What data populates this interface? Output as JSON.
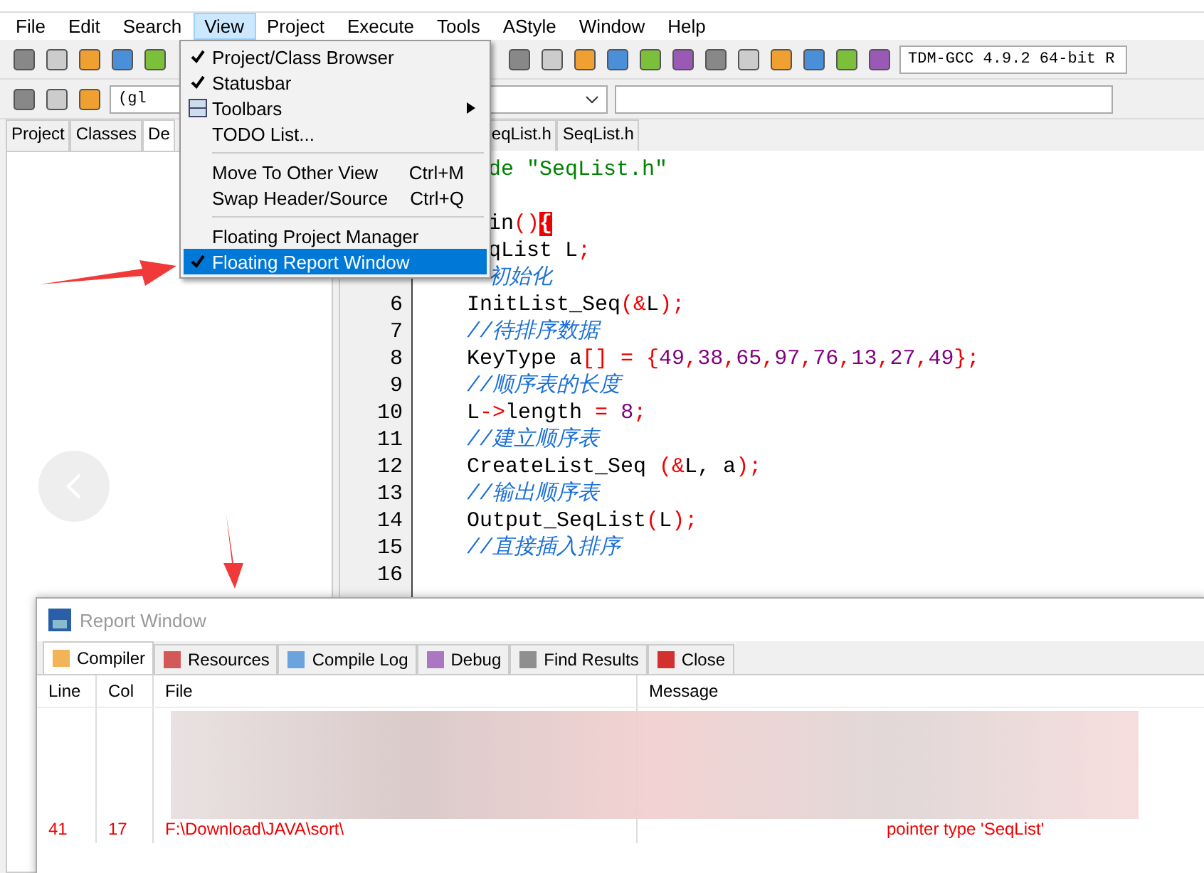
{
  "menu_bar": [
    {
      "label": "File",
      "selected": false
    },
    {
      "label": "Edit",
      "selected": false
    },
    {
      "label": "Search",
      "selected": false
    },
    {
      "label": "View",
      "selected": true
    },
    {
      "label": "Project",
      "selected": false
    },
    {
      "label": "Execute",
      "selected": false
    },
    {
      "label": "Tools",
      "selected": false
    },
    {
      "label": "AStyle",
      "selected": false
    },
    {
      "label": "Window",
      "selected": false
    },
    {
      "label": "Help",
      "selected": false
    }
  ],
  "compiler_select": {
    "value": "TDM-GCC 4.9.2 64-bit R"
  },
  "scope_select": {
    "value": "(gl"
  },
  "left_tabs": [
    {
      "label": "Project",
      "selected": false
    },
    {
      "label": "Classes",
      "selected": false
    },
    {
      "label": "De",
      "selected": true
    }
  ],
  "editor_tabs": [
    {
      "label": "eqList.h",
      "selected": false
    },
    {
      "label": "SeqList.h",
      "selected": false
    }
  ],
  "view_menu": [
    {
      "kind": "item",
      "label": "Project/Class Browser",
      "checked": true,
      "has_submenu": false,
      "highlighted": false
    },
    {
      "kind": "item",
      "label": "Statusbar",
      "checked": true,
      "has_submenu": false,
      "highlighted": false
    },
    {
      "kind": "toolbar",
      "label": "Toolbars",
      "has_submenu": true,
      "highlighted": false
    },
    {
      "kind": "item",
      "label": "TODO List...",
      "checked": false,
      "has_submenu": false,
      "highlighted": false
    },
    {
      "kind": "separator"
    },
    {
      "kind": "item",
      "label": "Move To Other View",
      "shortcut": "Ctrl+M",
      "checked": false,
      "has_submenu": false,
      "highlighted": false
    },
    {
      "kind": "item",
      "label": "Swap Header/Source",
      "shortcut": "Ctrl+Q",
      "checked": false,
      "has_submenu": false,
      "highlighted": false
    },
    {
      "kind": "separator"
    },
    {
      "kind": "item",
      "label": "Floating Project Manager",
      "checked": false,
      "has_submenu": false,
      "highlighted": false
    },
    {
      "kind": "item",
      "label": "Floating Report Window",
      "checked": true,
      "has_submenu": false,
      "highlighted": true
    }
  ],
  "code_lines": [
    {
      "partial": true,
      "tokens": [
        {
          "kind": "preproc",
          "text": "de \"SeqList.h\""
        }
      ]
    },
    {
      "partial": true
    },
    {
      "partial": true,
      "tokens": [
        {
          "kind": "plain",
          "text": "in"
        },
        {
          "kind": "symbol",
          "text": "()"
        },
        {
          "kind": "brace_match",
          "text": "{"
        }
      ]
    },
    {
      "partial": true,
      "tokens": [
        {
          "kind": "plain",
          "text": "qList L"
        },
        {
          "kind": "symbol",
          "text": ";"
        }
      ]
    },
    {
      "partial": true,
      "tokens": [
        {
          "kind": "comment",
          "text": "初始化"
        }
      ]
    },
    {
      "number": "6",
      "partial": false,
      "tokens": [
        {
          "kind": "plain",
          "text": "InitList_Seq"
        },
        {
          "kind": "symbol",
          "text": "(&"
        },
        {
          "kind": "plain",
          "text": "L"
        },
        {
          "kind": "symbol",
          "text": ");"
        }
      ]
    },
    {
      "number": "7",
      "partial": false,
      "tokens": [
        {
          "kind": "comment",
          "text": "//待排序数据"
        }
      ]
    },
    {
      "number": "8",
      "partial": false,
      "tokens": [
        {
          "kind": "plain",
          "text": "KeyType a"
        },
        {
          "kind": "symbol",
          "text": "[] = {"
        },
        {
          "kind": "number",
          "text": "49"
        },
        {
          "kind": "symbol",
          "text": ","
        },
        {
          "kind": "number",
          "text": "38"
        },
        {
          "kind": "symbol",
          "text": ","
        },
        {
          "kind": "number",
          "text": "65"
        },
        {
          "kind": "symbol",
          "text": ","
        },
        {
          "kind": "number",
          "text": "97"
        },
        {
          "kind": "symbol",
          "text": ","
        },
        {
          "kind": "number",
          "text": "76"
        },
        {
          "kind": "symbol",
          "text": ","
        },
        {
          "kind": "number",
          "text": "13"
        },
        {
          "kind": "symbol",
          "text": ","
        },
        {
          "kind": "number",
          "text": "27"
        },
        {
          "kind": "symbol",
          "text": ","
        },
        {
          "kind": "number",
          "text": "49"
        },
        {
          "kind": "symbol",
          "text": "};"
        }
      ]
    },
    {
      "number": "9",
      "partial": false,
      "tokens": [
        {
          "kind": "comment",
          "text": "//顺序表的长度"
        }
      ]
    },
    {
      "number": "10",
      "partial": false,
      "tokens": [
        {
          "kind": "plain",
          "text": "L"
        },
        {
          "kind": "symbol",
          "text": "->"
        },
        {
          "kind": "plain",
          "text": "length "
        },
        {
          "kind": "symbol",
          "text": "= "
        },
        {
          "kind": "number",
          "text": "8"
        },
        {
          "kind": "symbol",
          "text": ";"
        }
      ]
    },
    {
      "number": "11",
      "partial": false,
      "tokens": [
        {
          "kind": "comment",
          "text": "//建立顺序表"
        }
      ]
    },
    {
      "number": "12",
      "partial": false,
      "tokens": [
        {
          "kind": "plain",
          "text": "CreateList_Seq "
        },
        {
          "kind": "symbol",
          "text": "(&"
        },
        {
          "kind": "plain",
          "text": "L, a"
        },
        {
          "kind": "symbol",
          "text": ");"
        }
      ]
    },
    {
      "number": "13",
      "partial": false,
      "tokens": [
        {
          "kind": "comment",
          "text": "//输出顺序表"
        }
      ]
    },
    {
      "number": "14",
      "partial": false,
      "tokens": [
        {
          "kind": "plain",
          "text": "Output_SeqList"
        },
        {
          "kind": "symbol",
          "text": "("
        },
        {
          "kind": "plain",
          "text": "L"
        },
        {
          "kind": "symbol",
          "text": ");"
        }
      ]
    },
    {
      "number": "15",
      "partial": false,
      "tokens": [
        {
          "kind": "comment",
          "text": "//直接插入排序"
        }
      ]
    },
    {
      "number": "16",
      "partial": false
    }
  ],
  "report_window": {
    "title": "Report Window",
    "tabs": [
      {
        "label": "Compiler",
        "selected": true
      },
      {
        "label": "Resources",
        "selected": false
      },
      {
        "label": "Compile Log",
        "selected": false
      },
      {
        "label": "Debug",
        "selected": false
      },
      {
        "label": "Find Results",
        "selected": false
      },
      {
        "label": "Close",
        "selected": false
      }
    ],
    "columns": [
      "Line",
      "Col",
      "File",
      "Message"
    ],
    "rows": [
      {
        "line": "41",
        "col": "17",
        "file": "F:\\Download\\JAVA\\sort\\",
        "message": "pointer type 'SeqList'"
      }
    ]
  }
}
